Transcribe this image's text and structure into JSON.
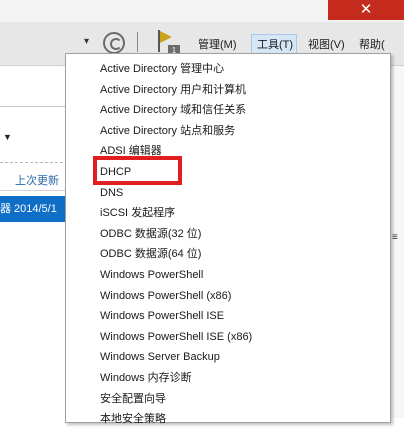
{
  "window": {
    "close_glyph": "✕",
    "close_color": "#c42b1c"
  },
  "toolbar": {
    "back_arrow_glyph": "▾",
    "refresh_icon": "refresh-icon",
    "flag_icon": "flag-icon",
    "notification_count": "1"
  },
  "menubar": {
    "manage": "管理(M)",
    "tools": "工具(T)",
    "view": "视图(V)",
    "help": "帮助("
  },
  "left_panel": {
    "caret_glyph": "▼",
    "column_header": "上次更新",
    "selected_row": {
      "name_fragment": "器",
      "date": "2014/5/1"
    },
    "selected_color": "#0f6fc6"
  },
  "right_panel": {
    "grip_glyph": "≡"
  },
  "tools_menu": {
    "items": [
      "Active Directory 管理中心",
      "Active Directory 用户和计算机",
      "Active Directory 域和信任关系",
      "Active Directory 站点和服务",
      "ADSI 编辑器",
      "DHCP",
      "DNS",
      "iSCSI 发起程序",
      "ODBC 数据源(32 位)",
      "ODBC 数据源(64 位)",
      "Windows PowerShell",
      "Windows PowerShell (x86)",
      "Windows PowerShell ISE",
      "Windows PowerShell ISE (x86)",
      "Windows Server Backup",
      "Windows 内存诊断",
      "安全配置向导",
      "本地安全策略"
    ],
    "highlighted_item": "DHCP",
    "highlight_color": "#e02020"
  }
}
